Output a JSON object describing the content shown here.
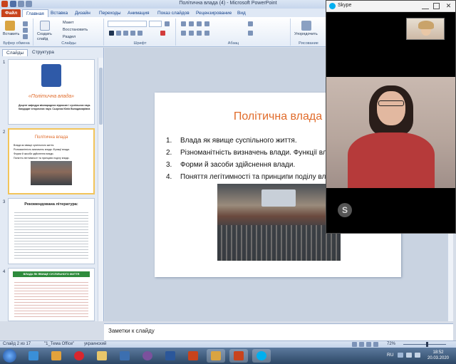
{
  "window": {
    "title": "Політична влада (4) - Microsoft PowerPoint"
  },
  "ribbon": {
    "tabs": [
      "Файл",
      "Главная",
      "Вставка",
      "Дизайн",
      "Переходы",
      "Анимация",
      "Показ слайдов",
      "Рецензирование",
      "Вид"
    ],
    "paste": "Вставить",
    "create_slide": "Создать слайд",
    "layout": "Макет",
    "restore": "Восстановить",
    "section": "Раздел",
    "arrange": "Упорядочить",
    "groups": {
      "clipboard": "Буфер обмена",
      "slides": "Слайды",
      "font": "Шрифт",
      "paragraph": "Абзац",
      "drawing": "Рисование"
    }
  },
  "panel": {
    "tabs": [
      "Слайды",
      "Структура"
    ],
    "thumb1": {
      "title": "«Політична влада»",
      "author": "Доцент кафедри міжнародних відносин і суспільних наук. Кандидат історичних наук. Сьорник Юлія Володимирівна"
    },
    "thumb2": {
      "title": "Політична влада",
      "items": [
        "Влада як явище суспільного життя.",
        "Різноманітність визначень влади. Функції влади.",
        "Форми й засоби здійснення влади.",
        "Поняття легітимності та принципи поділу влади."
      ]
    },
    "thumb3": {
      "title": "Рекомендована література:"
    },
    "thumb4": {
      "title": "ВЛАДА ЯК ЯВИЩЕ СУСПІЛЬНОГО ЖИТТЯ"
    },
    "numbers": [
      "1",
      "2",
      "3",
      "4"
    ]
  },
  "slide": {
    "title": "Політична влада",
    "bullets": [
      {
        "n": "1.",
        "text": "Влада як явище суспільного життя."
      },
      {
        "n": "2.",
        "text": "Різноманітність визначень влади. Функції влади."
      },
      {
        "n": "3.",
        "text": "Форми й засоби здійснення влади."
      },
      {
        "n": "4.",
        "text": "Поняття легітимності та принципи поділу влади."
      }
    ]
  },
  "notes": {
    "placeholder": "Заметки к слайду"
  },
  "status": {
    "slide_info": "Слайд 2 из 17",
    "theme": "\"1_Тема Office\"",
    "language": "украинский",
    "zoom": "72%"
  },
  "taskbar": {
    "lang": "RU",
    "time": "18:52",
    "date": "20.03.2020"
  },
  "skype": {
    "title": "Skype"
  },
  "colors": {
    "accent": "#e06b2a",
    "file_tab": "#c8431c"
  }
}
